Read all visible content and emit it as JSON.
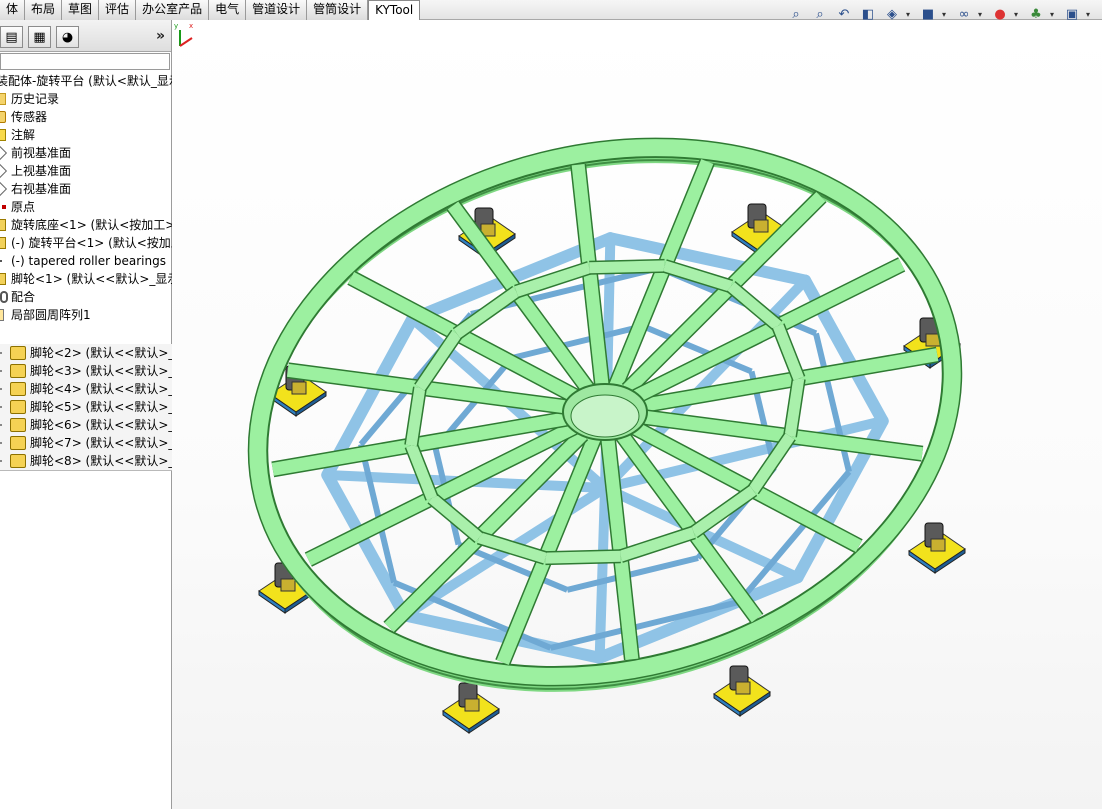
{
  "tabs": [
    "体",
    "布局",
    "草图",
    "评估",
    "办公室产品",
    "电气",
    "管道设计",
    "管筒设计",
    "KYTool"
  ],
  "active_tab": "KYTool",
  "heads_up_icons": [
    "zoom-to-fit-icon",
    "zoom-area-icon",
    "previous-view-icon",
    "section-view-icon",
    "view-orientation-icon",
    "display-style-icon",
    "hide-show-items-icon",
    "appearance-icon",
    "scene-icon",
    "view-settings-icon"
  ],
  "panel_tabs": [
    "feature-manager-icon",
    "property-manager-icon",
    "display-manager-icon"
  ],
  "panel_expand": "»",
  "tree": {
    "root": "装配体-旋转平台 (默认<默认_显示",
    "history": "历史记录",
    "sensors": "传感器",
    "annotations": "注解",
    "front_plane": "前视基准面",
    "top_plane": "上视基准面",
    "right_plane": "右视基准面",
    "origin": "原点",
    "base": "旋转底座<1> (默认<按加工>",
    "platform": "(-) 旋转平台<1> (默认<按加工",
    "bearing": "(-) tapered roller bearings",
    "caster1": "脚轮<1> (默认<<默认>_显示",
    "mates": "配合",
    "pattern": "局部圆周阵列1",
    "pattern_items": [
      "脚轮<2> (默认<<默认>_显",
      "脚轮<3> (默认<<默认>_显",
      "脚轮<4> (默认<<默认>_显",
      "脚轮<5> (默认<<默认>_显",
      "脚轮<6> (默认<<默认>_显",
      "脚轮<7> (默认<<默认>_显",
      "脚轮<8> (默认<<默认>_显"
    ]
  },
  "triad": {
    "x": "x",
    "y": "y"
  },
  "colors": {
    "ring": "#9cf0a0",
    "ring_edge": "#2f7a33",
    "base_frame": "#8fc3e6",
    "caster_pad": "#f2e21c",
    "caster_plate": "#2f7fbf"
  }
}
